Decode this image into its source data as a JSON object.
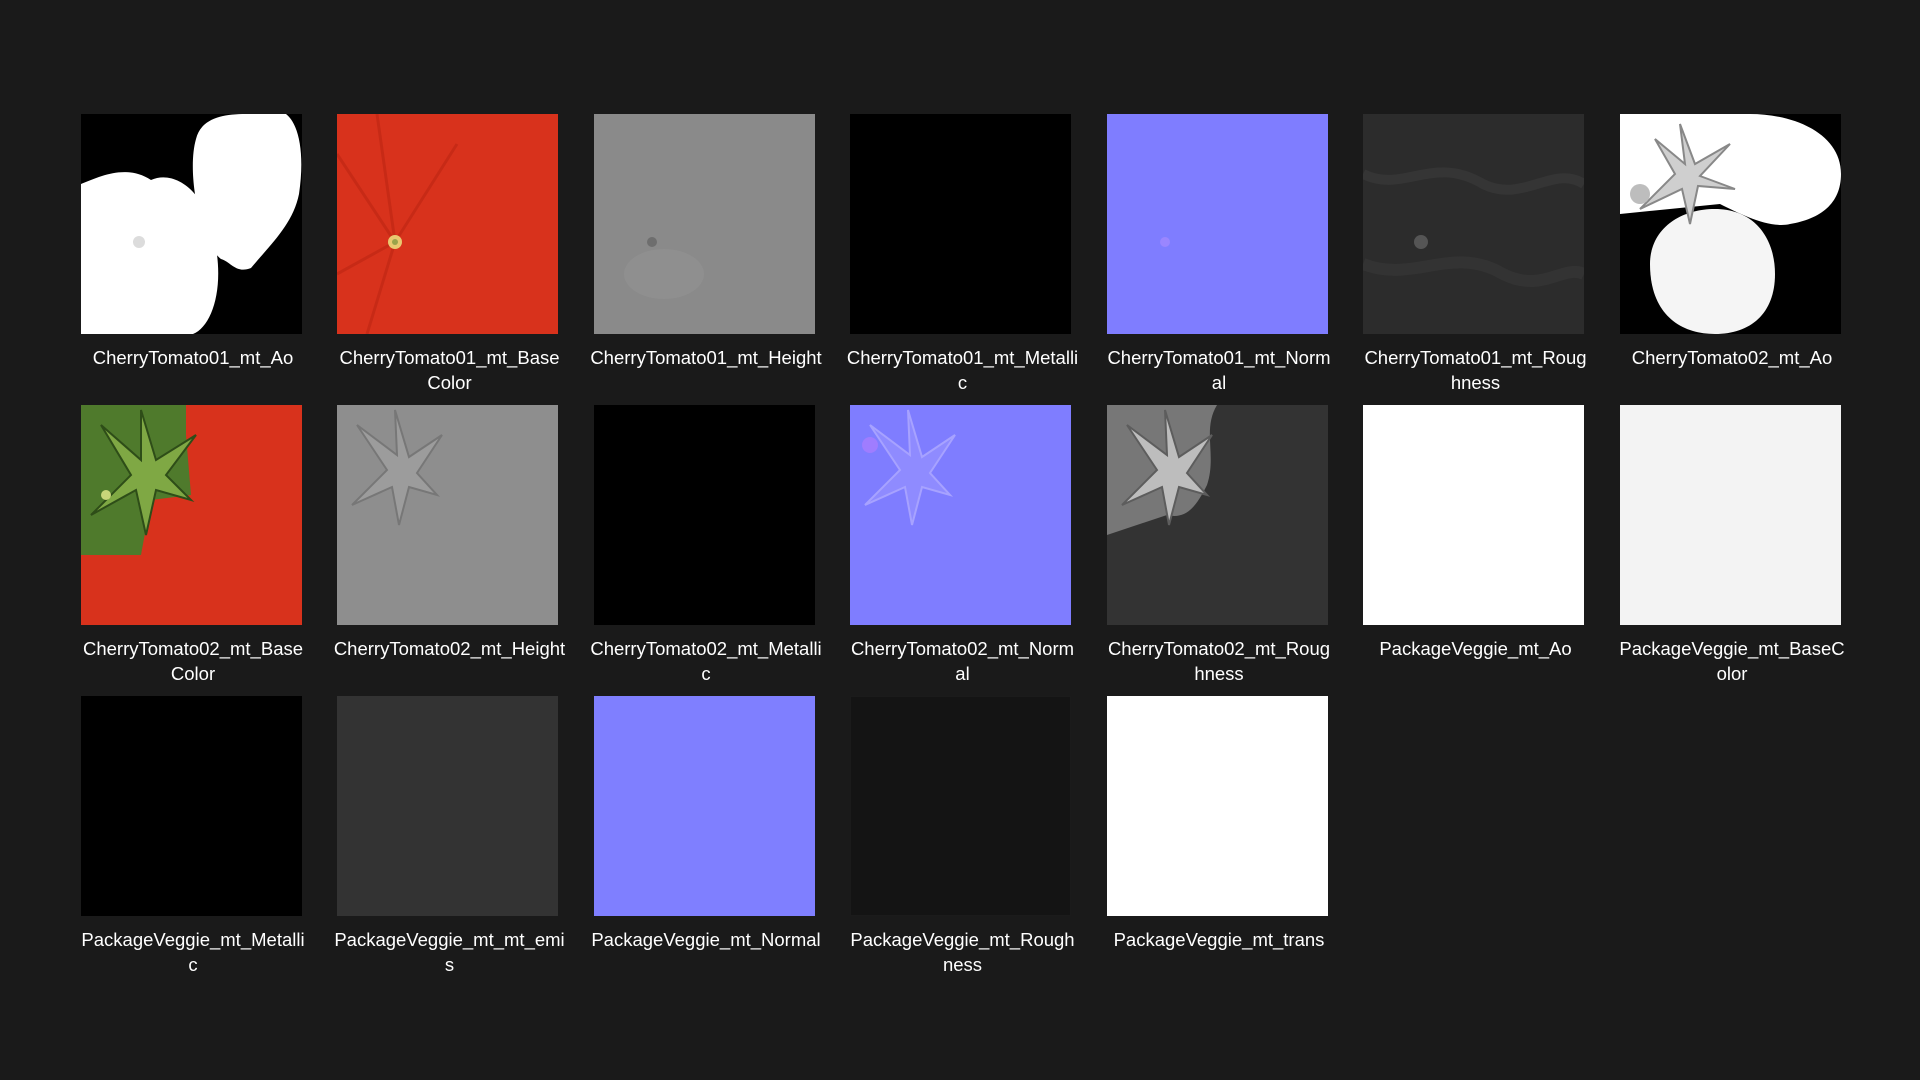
{
  "colors": {
    "background": "#1a1a1a",
    "label_text": "#ffffff",
    "normal_map_blue": "#8080ff",
    "tomato_red": "#d8321c"
  },
  "files": [
    {
      "name": "CherryTomato01_mt_Ao",
      "icon": "ao-two-tomatoes-thumbnail"
    },
    {
      "name": "CherryTomato01_mt_BaseColor",
      "icon": "red-basecolor-thumbnail"
    },
    {
      "name": "CherryTomato01_mt_Height",
      "icon": "gray-height-thumbnail"
    },
    {
      "name": "CherryTomato01_mt_Metallic",
      "icon": "black-metallic-thumbnail"
    },
    {
      "name": "CherryTomato01_mt_Normal",
      "icon": "blue-normal-thumbnail"
    },
    {
      "name": "CherryTomato01_mt_Roughness",
      "icon": "dark-roughness-thumbnail"
    },
    {
      "name": "CherryTomato02_mt_Ao",
      "icon": "ao-tomatoes-stem-thumbnail"
    },
    {
      "name": "CherryTomato02_mt_BaseColor",
      "icon": "red-green-basecolor-thumbnail"
    },
    {
      "name": "CherryTomato02_mt_Height",
      "icon": "gray-height-stem-thumbnail"
    },
    {
      "name": "CherryTomato02_mt_Metallic",
      "icon": "black-metallic-thumbnail"
    },
    {
      "name": "CherryTomato02_mt_Normal",
      "icon": "blue-normal-stem-thumbnail"
    },
    {
      "name": "CherryTomato02_mt_Roughness",
      "icon": "gray-roughness-stem-thumbnail"
    },
    {
      "name": "PackageVeggie_mt_Ao",
      "icon": "white-ao-thumbnail"
    },
    {
      "name": "PackageVeggie_mt_BaseColor",
      "icon": "offwhite-basecolor-thumbnail"
    },
    {
      "name": "PackageVeggie_mt_Metallic",
      "icon": "black-metallic-thumbnail"
    },
    {
      "name": "PackageVeggie_mt_mt_emis",
      "icon": "dark-gray-emissive-thumbnail"
    },
    {
      "name": "PackageVeggie_mt_Normal",
      "icon": "blue-normal-thumbnail"
    },
    {
      "name": "PackageVeggie_mt_Roughness",
      "icon": "near-black-roughness-thumbnail"
    },
    {
      "name": "PackageVeggie_mt_trans",
      "icon": "white-transmission-thumbnail"
    }
  ]
}
